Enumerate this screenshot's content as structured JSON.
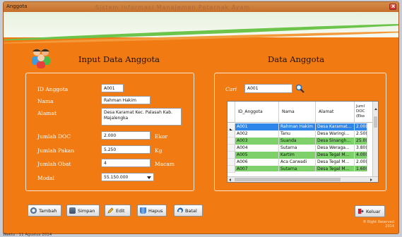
{
  "window": {
    "title": "Anggota",
    "ghost_title": "Sistem Informasi Manajemen Peternak Ayam"
  },
  "left": {
    "heading": "Input Data Anggota",
    "fields": {
      "id_label": "ID Anggota",
      "id_value": "A001",
      "nama_label": "Nama",
      "nama_value": "Rahman Hakim",
      "alamat_label": "Alamat",
      "alamat_value": "Desa Karamat Kec. Palasah Kab. Majalengka",
      "doc_label": "Jumlah DOC",
      "doc_value": "2.000",
      "doc_unit": "Ekor",
      "pakan_label": "Jumlah Pakan",
      "pakan_value": "5.250",
      "pakan_unit": "Kg",
      "obat_label": "Jumlah Obat",
      "obat_value": "4",
      "obat_unit": "Macam",
      "modal_label": "Modal",
      "modal_value": "55.150.000"
    }
  },
  "right": {
    "heading": "Data Anggota",
    "search_label": "Cari",
    "search_value": "A001",
    "columns": [
      "ID_Anggota",
      "Nama",
      "Alamat",
      "Juml DOC (Eko"
    ],
    "rows": [
      {
        "id": "A001",
        "nama": "Rahman Hakim",
        "alamat": "Desa Karamat...",
        "doc": "2.00("
      },
      {
        "id": "A002",
        "nama": "Tanu",
        "alamat": "Desa Waringi...",
        "doc": "2.50("
      },
      {
        "id": "A003",
        "nama": "Suanda",
        "alamat": "Desa Sinangh...",
        "doc": "25.0("
      },
      {
        "id": "A004",
        "nama": "Sutarna",
        "alamat": "Desa Weraga...",
        "doc": "3.80("
      },
      {
        "id": "A005",
        "nama": "Kartim",
        "alamat": "Desa Tegal M...",
        "doc": "4.00("
      },
      {
        "id": "A006",
        "nama": "Aca Carwadi",
        "alamat": "Desa Tegal M...",
        "doc": "2.00("
      },
      {
        "id": "A007",
        "nama": "Sutarna",
        "alamat": "Desa Tegal M...",
        "doc": "1.60("
      }
    ]
  },
  "buttons": {
    "tambah": "Tambah",
    "simpan": "Simpan",
    "edit": "Edit",
    "hapus": "Hapus",
    "batal": "Batal",
    "keluar": "Keluar"
  },
  "footer": {
    "copyright": "® Right Reserved",
    "year": "2014",
    "taskbar": "Waktu : 11 Agustus 2014"
  },
  "colors": {
    "window_bg": "#f27a12",
    "selected_row": "#2f86ea",
    "alt_row": "#7ed06b"
  }
}
